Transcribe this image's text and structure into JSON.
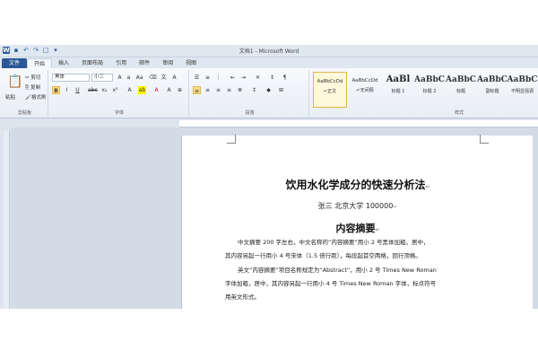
{
  "window": {
    "title": "文档1 - Microsoft Word"
  },
  "tabs": [
    "文件",
    "开始",
    "插入",
    "页面布局",
    "引用",
    "邮件",
    "审阅",
    "视图"
  ],
  "active_tab": "开始",
  "clipboard": {
    "paste": "粘贴",
    "cut": "剪切",
    "copy": "复制",
    "format_painter": "格式刷",
    "label": "剪贴板"
  },
  "font": {
    "name": "黑体",
    "size": "小三",
    "label": "字体"
  },
  "paragraph": {
    "label": "段落"
  },
  "styles": {
    "label": "样式",
    "items": [
      {
        "preview": "AaBbCcDd",
        "name": "↵正文",
        "kind": "small"
      },
      {
        "preview": "AaBbCcDd",
        "name": "↵无间隔",
        "kind": "small"
      },
      {
        "preview": "AaBl",
        "name": "标题 1",
        "kind": "big"
      },
      {
        "preview": "AaBbC",
        "name": "标题 2",
        "kind": "mid"
      },
      {
        "preview": "AaBbC",
        "name": "标题",
        "kind": "mid"
      },
      {
        "preview": "AaBbC",
        "name": "副标题",
        "kind": "mid"
      },
      {
        "preview": "AaBbC",
        "name": "不明显强调",
        "kind": "mid"
      }
    ]
  },
  "document": {
    "title": "饮用水化学成分的快速分析法",
    "author": "张三  北京大学  100000",
    "heading": "内容摘要",
    "para1": [
      "中文摘要 200 字左右，中文名称的“内容摘要”用小 2 号黑体加粗，居中，",
      "其内容另起一行用小 4 号宋体（1.5 倍行距），每段起首空两格，回行顶格。"
    ],
    "para2": [
      "英文“内容摘要”项目名称规定为“Abstract”，用小 2 号 Times New Roman",
      "字体加粗，居中，其内容另起一行用小 4 号 Times New Roman 字体，标点符号",
      "用英文形式。"
    ]
  }
}
